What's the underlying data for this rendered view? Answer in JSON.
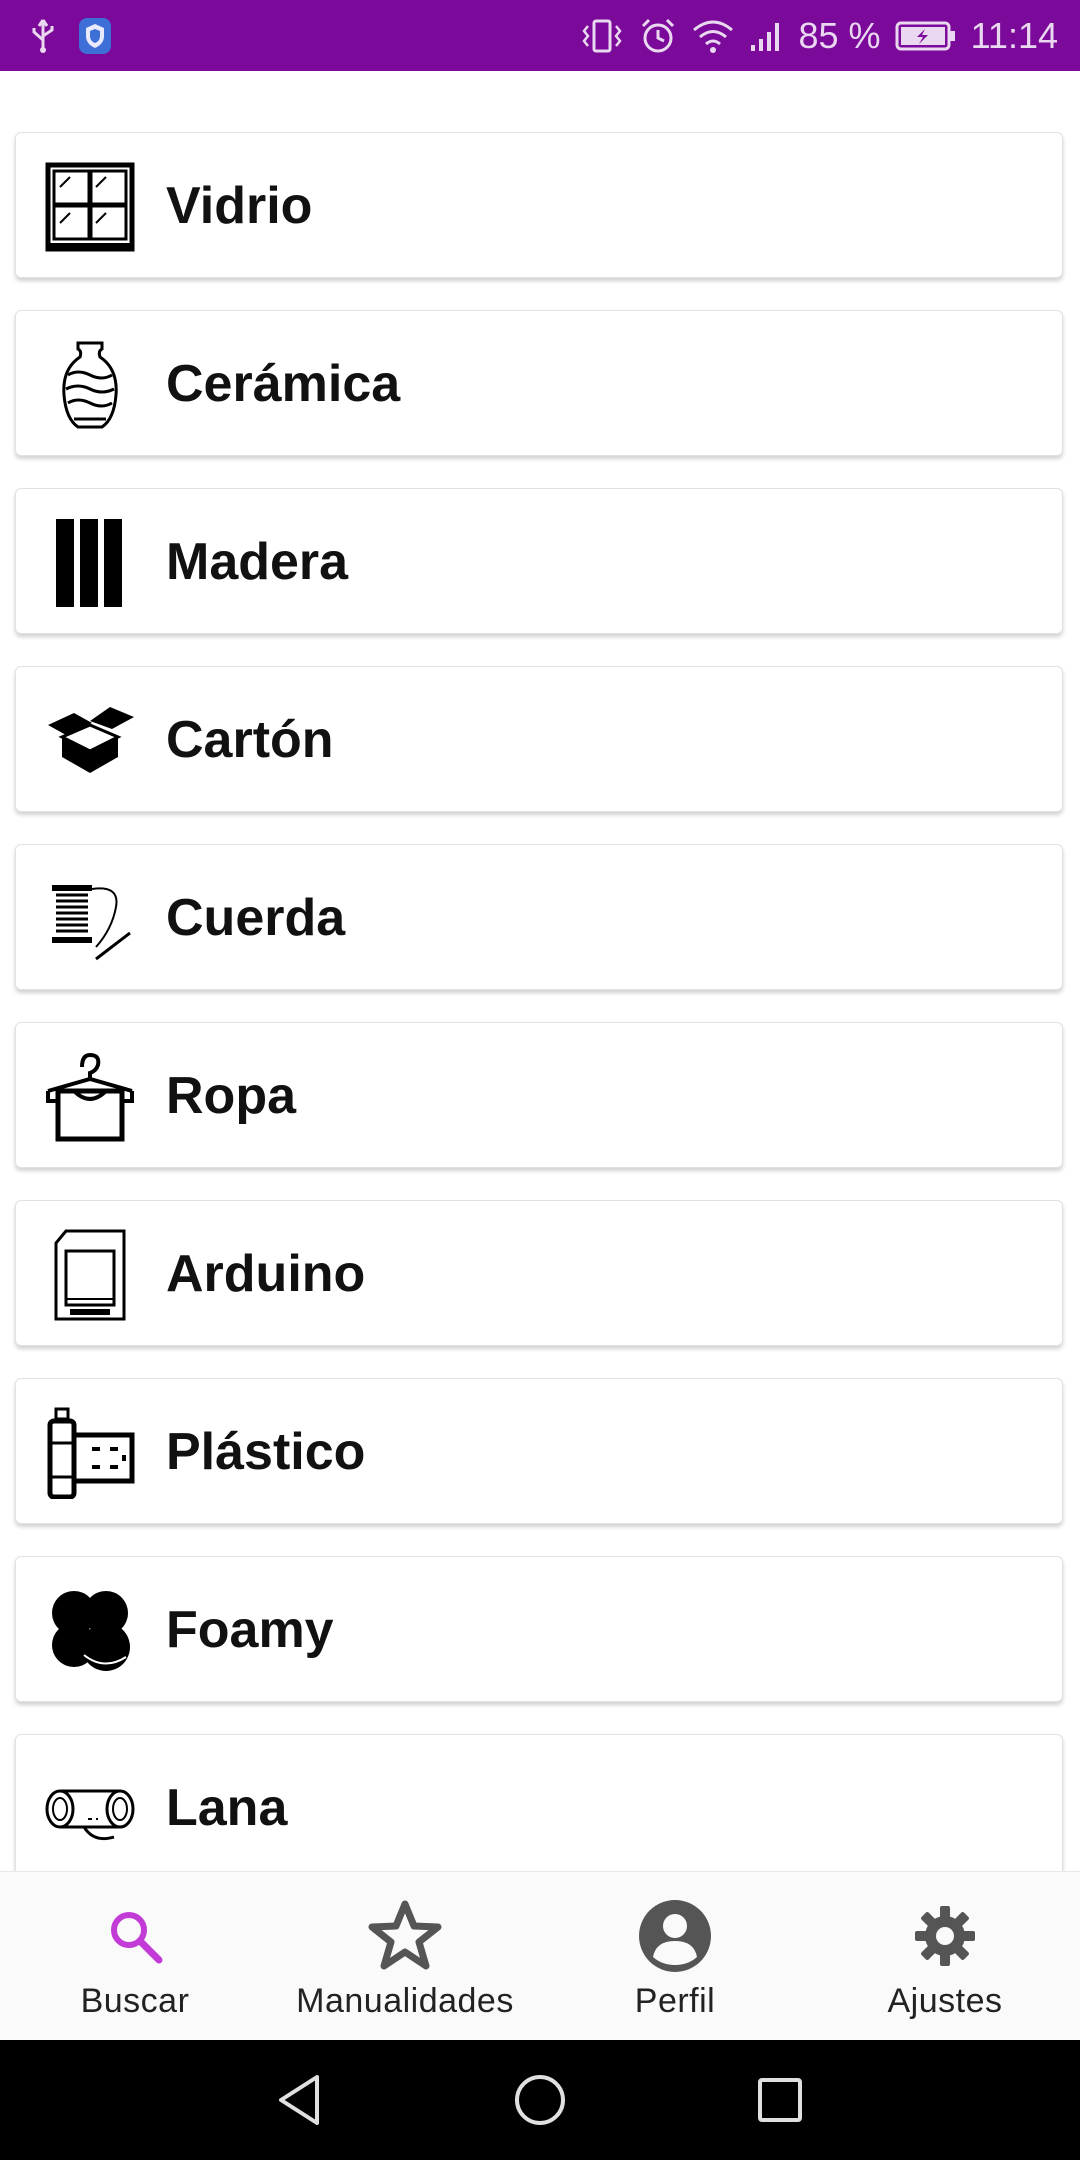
{
  "status_bar": {
    "battery_percent": "85 %",
    "time": "11:14",
    "bg_color": "#7b0a9a",
    "icons": [
      "usb-icon",
      "shield-icon",
      "vibrate-icon",
      "alarm-icon",
      "wifi-icon",
      "signal-icon",
      "battery-charging-icon"
    ]
  },
  "categories": [
    {
      "label": "Vidrio",
      "icon": "window-icon"
    },
    {
      "label": "Cerámica",
      "icon": "vase-icon"
    },
    {
      "label": "Madera",
      "icon": "wood-planks-icon"
    },
    {
      "label": "Cartón",
      "icon": "box-icon"
    },
    {
      "label": "Cuerda",
      "icon": "thread-needle-icon"
    },
    {
      "label": "Ropa",
      "icon": "hanger-icon"
    },
    {
      "label": "Arduino",
      "icon": "sd-card-icon"
    },
    {
      "label": "Plástico",
      "icon": "bottle-icon"
    },
    {
      "label": "Foamy",
      "icon": "foam-shape-icon"
    },
    {
      "label": "Lana",
      "icon": "yarn-icon"
    }
  ],
  "bottom_nav": {
    "items": [
      {
        "label": "Buscar",
        "icon": "search-icon",
        "active": true
      },
      {
        "label": "Manualidades",
        "icon": "star-icon",
        "active": false
      },
      {
        "label": "Perfil",
        "icon": "account-icon",
        "active": false
      },
      {
        "label": "Ajustes",
        "icon": "gear-icon",
        "active": false
      }
    ],
    "active_color": "#c23bd6",
    "inactive_color": "#555555"
  },
  "system_nav": {
    "icons": [
      "back-icon",
      "home-icon",
      "recents-icon"
    ]
  }
}
